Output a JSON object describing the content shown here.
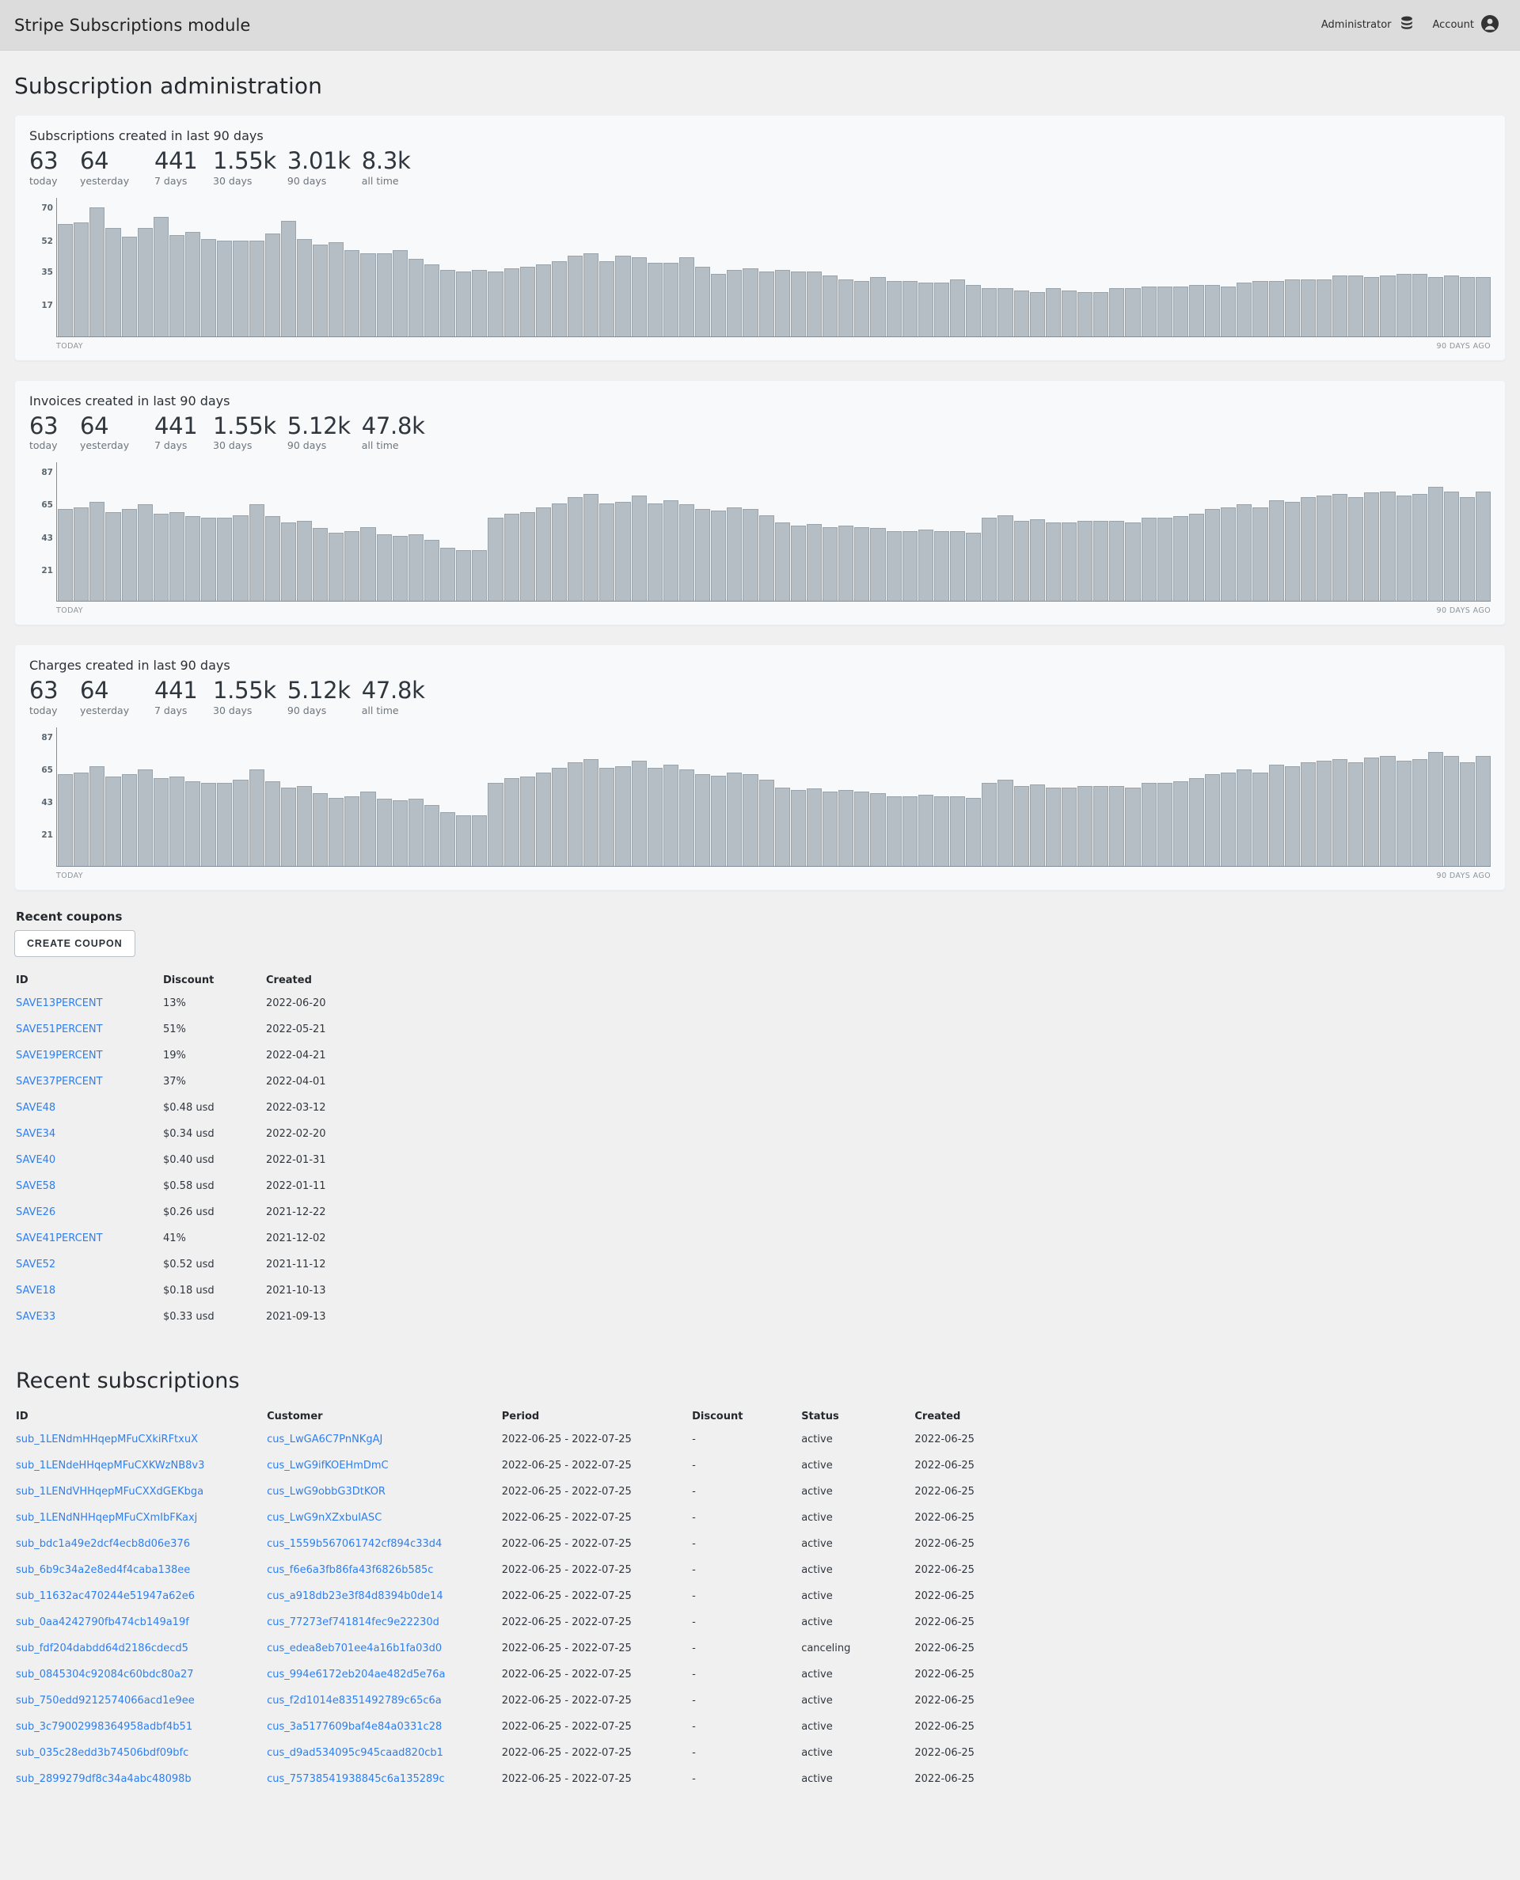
{
  "topbar": {
    "title": "Stripe Subscriptions module",
    "admin_label": "Administrator",
    "admin_icon": "database-stack-icon",
    "account_label": "Account",
    "account_icon": "user-circle-icon"
  },
  "page": {
    "title": "Subscription administration"
  },
  "charts": [
    {
      "title": "Subscriptions created in last 90 days",
      "stats": [
        {
          "value": "63",
          "label": "today",
          "width": 50
        },
        {
          "value": "64",
          "label": "yesterday",
          "width": 80
        },
        {
          "value": "441",
          "label": "7 days",
          "width": 60
        },
        {
          "value": "1.55k",
          "label": "30 days",
          "width": 68
        },
        {
          "value": "3.01k",
          "label": "90 days",
          "width": 68
        },
        {
          "value": "8.3k",
          "label": "all time",
          "width": 68
        }
      ],
      "x_left": "TODAY",
      "x_right": "90 DAYS AGO",
      "chart_data": {
        "type": "bar",
        "title": "Subscriptions created in last 90 days",
        "xlabel": "",
        "ylabel": "",
        "grid": false,
        "legend": "none",
        "yticks": [
          70,
          52,
          35,
          17
        ],
        "ylim": [
          0,
          76
        ],
        "x": [
          "TODAY",
          "90 DAYS AGO"
        ],
        "values": [
          61,
          62,
          70,
          59,
          54,
          59,
          65,
          55,
          57,
          53,
          52,
          52,
          52,
          56,
          63,
          53,
          50,
          51,
          47,
          45,
          45,
          47,
          42,
          39,
          36,
          35,
          36,
          35,
          37,
          38,
          39,
          41,
          44,
          45,
          41,
          44,
          43,
          40,
          40,
          43,
          38,
          34,
          36,
          37,
          35,
          36,
          35,
          35,
          33,
          31,
          30,
          32,
          30,
          30,
          29,
          29,
          31,
          28,
          26,
          26,
          25,
          24,
          26,
          25,
          24,
          24,
          26,
          26,
          27,
          27,
          27,
          28,
          28,
          27,
          29,
          30,
          30,
          31,
          31,
          31,
          33,
          33,
          32,
          33,
          34,
          34,
          32,
          33,
          32,
          32
        ]
      }
    },
    {
      "title": "Invoices created in last 90 days",
      "stats": [
        {
          "value": "63",
          "label": "today",
          "width": 50
        },
        {
          "value": "64",
          "label": "yesterday",
          "width": 80
        },
        {
          "value": "441",
          "label": "7 days",
          "width": 60
        },
        {
          "value": "1.55k",
          "label": "30 days",
          "width": 68
        },
        {
          "value": "5.12k",
          "label": "90 days",
          "width": 68
        },
        {
          "value": "47.8k",
          "label": "all time",
          "width": 68
        }
      ],
      "x_left": "TODAY",
      "x_right": "90 DAYS AGO",
      "chart_data": {
        "type": "bar",
        "title": "Invoices created in last 90 days",
        "xlabel": "",
        "ylabel": "",
        "grid": false,
        "legend": "none",
        "yticks": [
          87,
          65,
          43,
          21
        ],
        "ylim": [
          0,
          94
        ],
        "x": [
          "TODAY",
          "90 DAYS AGO"
        ],
        "values": [
          62,
          63,
          67,
          60,
          62,
          65,
          59,
          60,
          57,
          56,
          56,
          58,
          65,
          57,
          53,
          54,
          49,
          46,
          47,
          50,
          45,
          44,
          45,
          41,
          36,
          34,
          34,
          56,
          59,
          60,
          63,
          66,
          70,
          72,
          66,
          67,
          71,
          66,
          68,
          65,
          62,
          61,
          63,
          62,
          58,
          53,
          51,
          52,
          50,
          51,
          50,
          49,
          47,
          47,
          48,
          47,
          47,
          46,
          56,
          58,
          54,
          55,
          53,
          53,
          54,
          54,
          54,
          53,
          56,
          56,
          57,
          59,
          62,
          63,
          65,
          63,
          68,
          67,
          70,
          71,
          72,
          70,
          73,
          74,
          71,
          72,
          77,
          74,
          70,
          74
        ]
      }
    },
    {
      "title": "Charges created in last 90 days",
      "stats": [
        {
          "value": "63",
          "label": "today",
          "width": 50
        },
        {
          "value": "64",
          "label": "yesterday",
          "width": 80
        },
        {
          "value": "441",
          "label": "7 days",
          "width": 60
        },
        {
          "value": "1.55k",
          "label": "30 days",
          "width": 68
        },
        {
          "value": "5.12k",
          "label": "90 days",
          "width": 68
        },
        {
          "value": "47.8k",
          "label": "all time",
          "width": 68
        }
      ],
      "x_left": "TODAY",
      "x_right": "90 DAYS AGO",
      "chart_data": {
        "type": "bar",
        "title": "Charges created in last 90 days",
        "xlabel": "",
        "ylabel": "",
        "grid": false,
        "legend": "none",
        "yticks": [
          87,
          65,
          43,
          21
        ],
        "ylim": [
          0,
          94
        ],
        "x": [
          "TODAY",
          "90 DAYS AGO"
        ],
        "values": [
          62,
          63,
          67,
          60,
          62,
          65,
          59,
          60,
          57,
          56,
          56,
          58,
          65,
          57,
          53,
          54,
          49,
          46,
          47,
          50,
          45,
          44,
          45,
          41,
          36,
          34,
          34,
          56,
          59,
          60,
          63,
          66,
          70,
          72,
          66,
          67,
          71,
          66,
          68,
          65,
          62,
          61,
          63,
          62,
          58,
          53,
          51,
          52,
          50,
          51,
          50,
          49,
          47,
          47,
          48,
          47,
          47,
          46,
          56,
          58,
          54,
          55,
          53,
          53,
          54,
          54,
          54,
          53,
          56,
          56,
          57,
          59,
          62,
          63,
          65,
          63,
          68,
          67,
          70,
          71,
          72,
          70,
          73,
          74,
          71,
          72,
          77,
          74,
          70,
          74
        ]
      }
    }
  ],
  "coupons": {
    "heading": "Recent coupons",
    "create_button": "CREATE COUPON",
    "columns": [
      "ID",
      "Discount",
      "Created"
    ],
    "rows": [
      {
        "id": "SAVE13PERCENT",
        "discount": "13%",
        "created": "2022-06-20"
      },
      {
        "id": "SAVE51PERCENT",
        "discount": "51%",
        "created": "2022-05-21"
      },
      {
        "id": "SAVE19PERCENT",
        "discount": "19%",
        "created": "2022-04-21"
      },
      {
        "id": "SAVE37PERCENT",
        "discount": "37%",
        "created": "2022-04-01"
      },
      {
        "id": "SAVE48",
        "discount": "$0.48 usd",
        "created": "2022-03-12"
      },
      {
        "id": "SAVE34",
        "discount": "$0.34 usd",
        "created": "2022-02-20"
      },
      {
        "id": "SAVE40",
        "discount": "$0.40 usd",
        "created": "2022-01-31"
      },
      {
        "id": "SAVE58",
        "discount": "$0.58 usd",
        "created": "2022-01-11"
      },
      {
        "id": "SAVE26",
        "discount": "$0.26 usd",
        "created": "2021-12-22"
      },
      {
        "id": "SAVE41PERCENT",
        "discount": "41%",
        "created": "2021-12-02"
      },
      {
        "id": "SAVE52",
        "discount": "$0.52 usd",
        "created": "2021-11-12"
      },
      {
        "id": "SAVE18",
        "discount": "$0.18 usd",
        "created": "2021-10-13"
      },
      {
        "id": "SAVE33",
        "discount": "$0.33 usd",
        "created": "2021-09-13"
      }
    ]
  },
  "subscriptions": {
    "heading": "Recent subscriptions",
    "columns": [
      "ID",
      "Customer",
      "Period",
      "Discount",
      "Status",
      "Created"
    ],
    "rows": [
      {
        "id": "sub_1LENdmHHqepMFuCXkiRFtxuX",
        "customer": "cus_LwGA6C7PnNKgAJ",
        "period": "2022-06-25 - 2022-07-25",
        "discount": "-",
        "status": "active",
        "created": "2022-06-25"
      },
      {
        "id": "sub_1LENdeHHqepMFuCXKWzNB8v3",
        "customer": "cus_LwG9ifKOEHmDmC",
        "period": "2022-06-25 - 2022-07-25",
        "discount": "-",
        "status": "active",
        "created": "2022-06-25"
      },
      {
        "id": "sub_1LENdVHHqepMFuCXXdGEKbga",
        "customer": "cus_LwG9obbG3DtKOR",
        "period": "2022-06-25 - 2022-07-25",
        "discount": "-",
        "status": "active",
        "created": "2022-06-25"
      },
      {
        "id": "sub_1LENdNHHqepMFuCXmIbFKaxj",
        "customer": "cus_LwG9nXZxbuIASC",
        "period": "2022-06-25 - 2022-07-25",
        "discount": "-",
        "status": "active",
        "created": "2022-06-25"
      },
      {
        "id": "sub_bdc1a49e2dcf4ecb8d06e376",
        "customer": "cus_1559b567061742cf894c33d4",
        "period": "2022-06-25 - 2022-07-25",
        "discount": "-",
        "status": "active",
        "created": "2022-06-25"
      },
      {
        "id": "sub_6b9c34a2e8ed4f4caba138ee",
        "customer": "cus_f6e6a3fb86fa43f6826b585c",
        "period": "2022-06-25 - 2022-07-25",
        "discount": "-",
        "status": "active",
        "created": "2022-06-25"
      },
      {
        "id": "sub_11632ac470244e51947a62e6",
        "customer": "cus_a918db23e3f84d8394b0de14",
        "period": "2022-06-25 - 2022-07-25",
        "discount": "-",
        "status": "active",
        "created": "2022-06-25"
      },
      {
        "id": "sub_0aa4242790fb474cb149a19f",
        "customer": "cus_77273ef741814fec9e22230d",
        "period": "2022-06-25 - 2022-07-25",
        "discount": "-",
        "status": "active",
        "created": "2022-06-25"
      },
      {
        "id": "sub_fdf204dabdd64d2186cdecd5",
        "customer": "cus_edea8eb701ee4a16b1fa03d0",
        "period": "2022-06-25 - 2022-07-25",
        "discount": "-",
        "status": "canceling",
        "created": "2022-06-25"
      },
      {
        "id": "sub_0845304c92084c60bdc80a27",
        "customer": "cus_994e6172eb204ae482d5e76a",
        "period": "2022-06-25 - 2022-07-25",
        "discount": "-",
        "status": "active",
        "created": "2022-06-25"
      },
      {
        "id": "sub_750edd9212574066acd1e9ee",
        "customer": "cus_f2d1014e8351492789c65c6a",
        "period": "2022-06-25 - 2022-07-25",
        "discount": "-",
        "status": "active",
        "created": "2022-06-25"
      },
      {
        "id": "sub_3c79002998364958adbf4b51",
        "customer": "cus_3a5177609baf4e84a0331c28",
        "period": "2022-06-25 - 2022-07-25",
        "discount": "-",
        "status": "active",
        "created": "2022-06-25"
      },
      {
        "id": "sub_035c28edd3b74506bdf09bfc",
        "customer": "cus_d9ad534095c945caad820cb1",
        "period": "2022-06-25 - 2022-07-25",
        "discount": "-",
        "status": "active",
        "created": "2022-06-25"
      },
      {
        "id": "sub_2899279df8c34a4abc48098b",
        "customer": "cus_75738541938845c6a135289c",
        "period": "2022-06-25 - 2022-07-25",
        "discount": "-",
        "status": "active",
        "created": "2022-06-25"
      }
    ]
  },
  "colors": {
    "topbar_bg": "#dcdcdc",
    "page_bg": "#f0f0f0",
    "card_bg": "#f7f9fa",
    "bar_fill": "#b6bec5",
    "bar_stroke": "#9aa4ad",
    "link": "#2d7ff0",
    "text": "#30363d"
  }
}
